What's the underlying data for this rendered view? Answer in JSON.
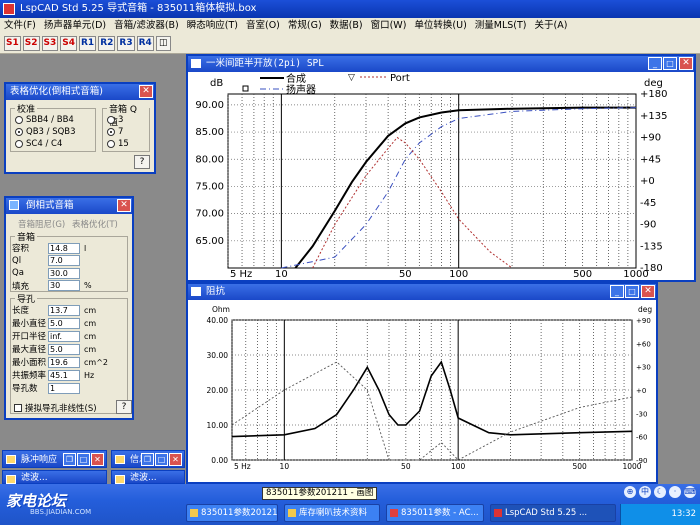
{
  "app": {
    "title": "LspCAD Std 5.25 导式音箱 - 835011箱体模拟.box"
  },
  "menu": [
    "文件(F)",
    "扬声器单元(D)",
    "音箱/滤波器(B)",
    "瞬态响应(T)",
    "音室(O)",
    "常规(G)",
    "数据(B)",
    "窗口(W)",
    "单位转换(U)",
    "测量MLS(T)",
    "关于(A)"
  ],
  "toolbar": {
    "buttons": [
      "S1",
      "S2",
      "S3",
      "S4",
      "R1",
      "R2",
      "R3",
      "R4"
    ]
  },
  "align_win": {
    "title": "表格优化(倒相式音箱)",
    "group1": "校准",
    "options": [
      "SBB4 / BB4",
      "QB3 / SQB3",
      "SC4 / C4"
    ],
    "selected_option": 1,
    "group2": "音箱 Q 值",
    "q_options": [
      "3",
      "7",
      "15"
    ],
    "selected_q": 1,
    "help": "?"
  },
  "vented_win": {
    "title": "倒相式音箱",
    "tabs": [
      "音箱阻尼(G)",
      "表格优化(T)"
    ],
    "box_group": "音箱",
    "box_fields": [
      {
        "label": "容积",
        "value": "14.8",
        "unit": "l"
      },
      {
        "label": "Ql",
        "value": "7.0",
        "unit": ""
      },
      {
        "label": "Qa",
        "value": "30.0",
        "unit": ""
      },
      {
        "label": "填充",
        "value": "30",
        "unit": "%"
      }
    ],
    "port_group": "导孔",
    "port_fields": [
      {
        "label": "长度",
        "value": "13.7",
        "unit": "cm"
      },
      {
        "label": "最小直径",
        "value": "5.0",
        "unit": "cm"
      },
      {
        "label": "开口半径",
        "value": "inf.",
        "unit": "cm"
      },
      {
        "label": "最大直径",
        "value": "5.0",
        "unit": "cm"
      },
      {
        "label": "最小面积",
        "value": "19.6",
        "unit": "cm^2"
      },
      {
        "label": "共振频率",
        "value": "45.1",
        "unit": "Hz"
      },
      {
        "label": "导孔数",
        "value": "1",
        "unit": ""
      }
    ],
    "nonlinear_label": "摸拟导孔非线性(S)",
    "help": "?"
  },
  "minimized": [
    {
      "label": "脉冲响应"
    },
    {
      "label": "信息"
    },
    {
      "label": "滤波..."
    },
    {
      "label": "滤波..."
    }
  ],
  "spl_win": {
    "title": "一米间距半开放(2pi) SPL",
    "legend": {
      "total": "合成",
      "driver": "扬声器",
      "port": "Port"
    }
  },
  "imp_win": {
    "title": "阻抗"
  },
  "chart_data": [
    {
      "type": "line",
      "title": "一米间距半开放(2pi) SPL",
      "xlabel": "Hz",
      "ylabel": "dB",
      "y2label": "deg",
      "xscale": "log",
      "xlim": [
        5,
        1000
      ],
      "ylim": [
        60,
        92
      ],
      "y2lim": [
        -180,
        180
      ],
      "x_ticks": [
        "5 Hz",
        "10",
        "50",
        "100",
        "500",
        "1000"
      ],
      "y_ticks": [
        "65.00",
        "70.00",
        "75.00",
        "80.00",
        "85.00",
        "90.00"
      ],
      "y2_ticks": [
        "-180",
        "-135",
        "-90",
        "-45",
        "+0",
        "+45",
        "+90",
        "+135",
        "+180"
      ],
      "series": [
        {
          "name": "合成",
          "x": [
            12,
            15,
            20,
            25,
            30,
            40,
            50,
            60,
            80,
            100,
            200,
            500,
            1000
          ],
          "values": [
            60,
            64,
            70.5,
            75.8,
            79.5,
            84.3,
            86.6,
            87.7,
            88.6,
            89.0,
            89.3,
            89.5,
            89.5
          ]
        },
        {
          "name": "扬声器",
          "x": [
            10,
            20,
            30,
            40,
            50,
            60,
            80,
            100,
            200,
            500,
            1000
          ],
          "values": [
            60,
            62,
            68,
            74,
            80,
            83,
            86,
            87.5,
            88.8,
            89.3,
            89.5
          ]
        },
        {
          "name": "Port",
          "x": [
            15,
            20,
            30,
            40,
            45,
            50,
            60,
            80,
            100,
            150,
            200
          ],
          "values": [
            60,
            68,
            77,
            82,
            84,
            83,
            80,
            74,
            69,
            63,
            60
          ]
        }
      ]
    },
    {
      "type": "line",
      "title": "阻抗",
      "xlabel": "Hz",
      "ylabel": "Ohm",
      "y2label": "deg",
      "xscale": "log",
      "xlim": [
        5,
        1000
      ],
      "ylim": [
        0,
        40
      ],
      "y2lim": [
        -90,
        90
      ],
      "x_ticks": [
        "5 Hz",
        "10",
        "50",
        "100",
        "500",
        "1000"
      ],
      "y_ticks": [
        "0.00",
        "10.00",
        "20.00",
        "30.00",
        "40.00"
      ],
      "y2_ticks": [
        "-90",
        "-60",
        "-30",
        "+0",
        "+30",
        "+60",
        "+90"
      ],
      "series": [
        {
          "name": "Impedance",
          "x": [
            5,
            10,
            15,
            20,
            25,
            30,
            35,
            40,
            45,
            50,
            60,
            70,
            80,
            90,
            100,
            150,
            200,
            500,
            1000
          ],
          "values": [
            6.7,
            7.2,
            9,
            13,
            20,
            26.5,
            20,
            13,
            10,
            10,
            14,
            24,
            28,
            20,
            12,
            7.8,
            7.2,
            7.8,
            8.2
          ]
        },
        {
          "name": "Phase",
          "x": [
            5,
            10,
            20,
            30,
            40,
            50,
            60,
            80,
            100,
            200,
            500,
            1000
          ],
          "values": [
            10,
            20,
            28,
            20,
            -10,
            -20,
            -10,
            5,
            0,
            8,
            15,
            18
          ]
        }
      ]
    }
  ],
  "taskbar": {
    "tooltip": "835011参数201211 - 画图",
    "buttons": [
      "835011参数20121...",
      "库存喇叭技术资料",
      "835011参数 - AC...",
      "LspCAD Std 5.25 ..."
    ],
    "active": 3,
    "clock": "13:32",
    "ime": "中"
  },
  "watermark": {
    "brand": "家电论坛",
    "sub": "BBS.JIADIAN.COM"
  }
}
